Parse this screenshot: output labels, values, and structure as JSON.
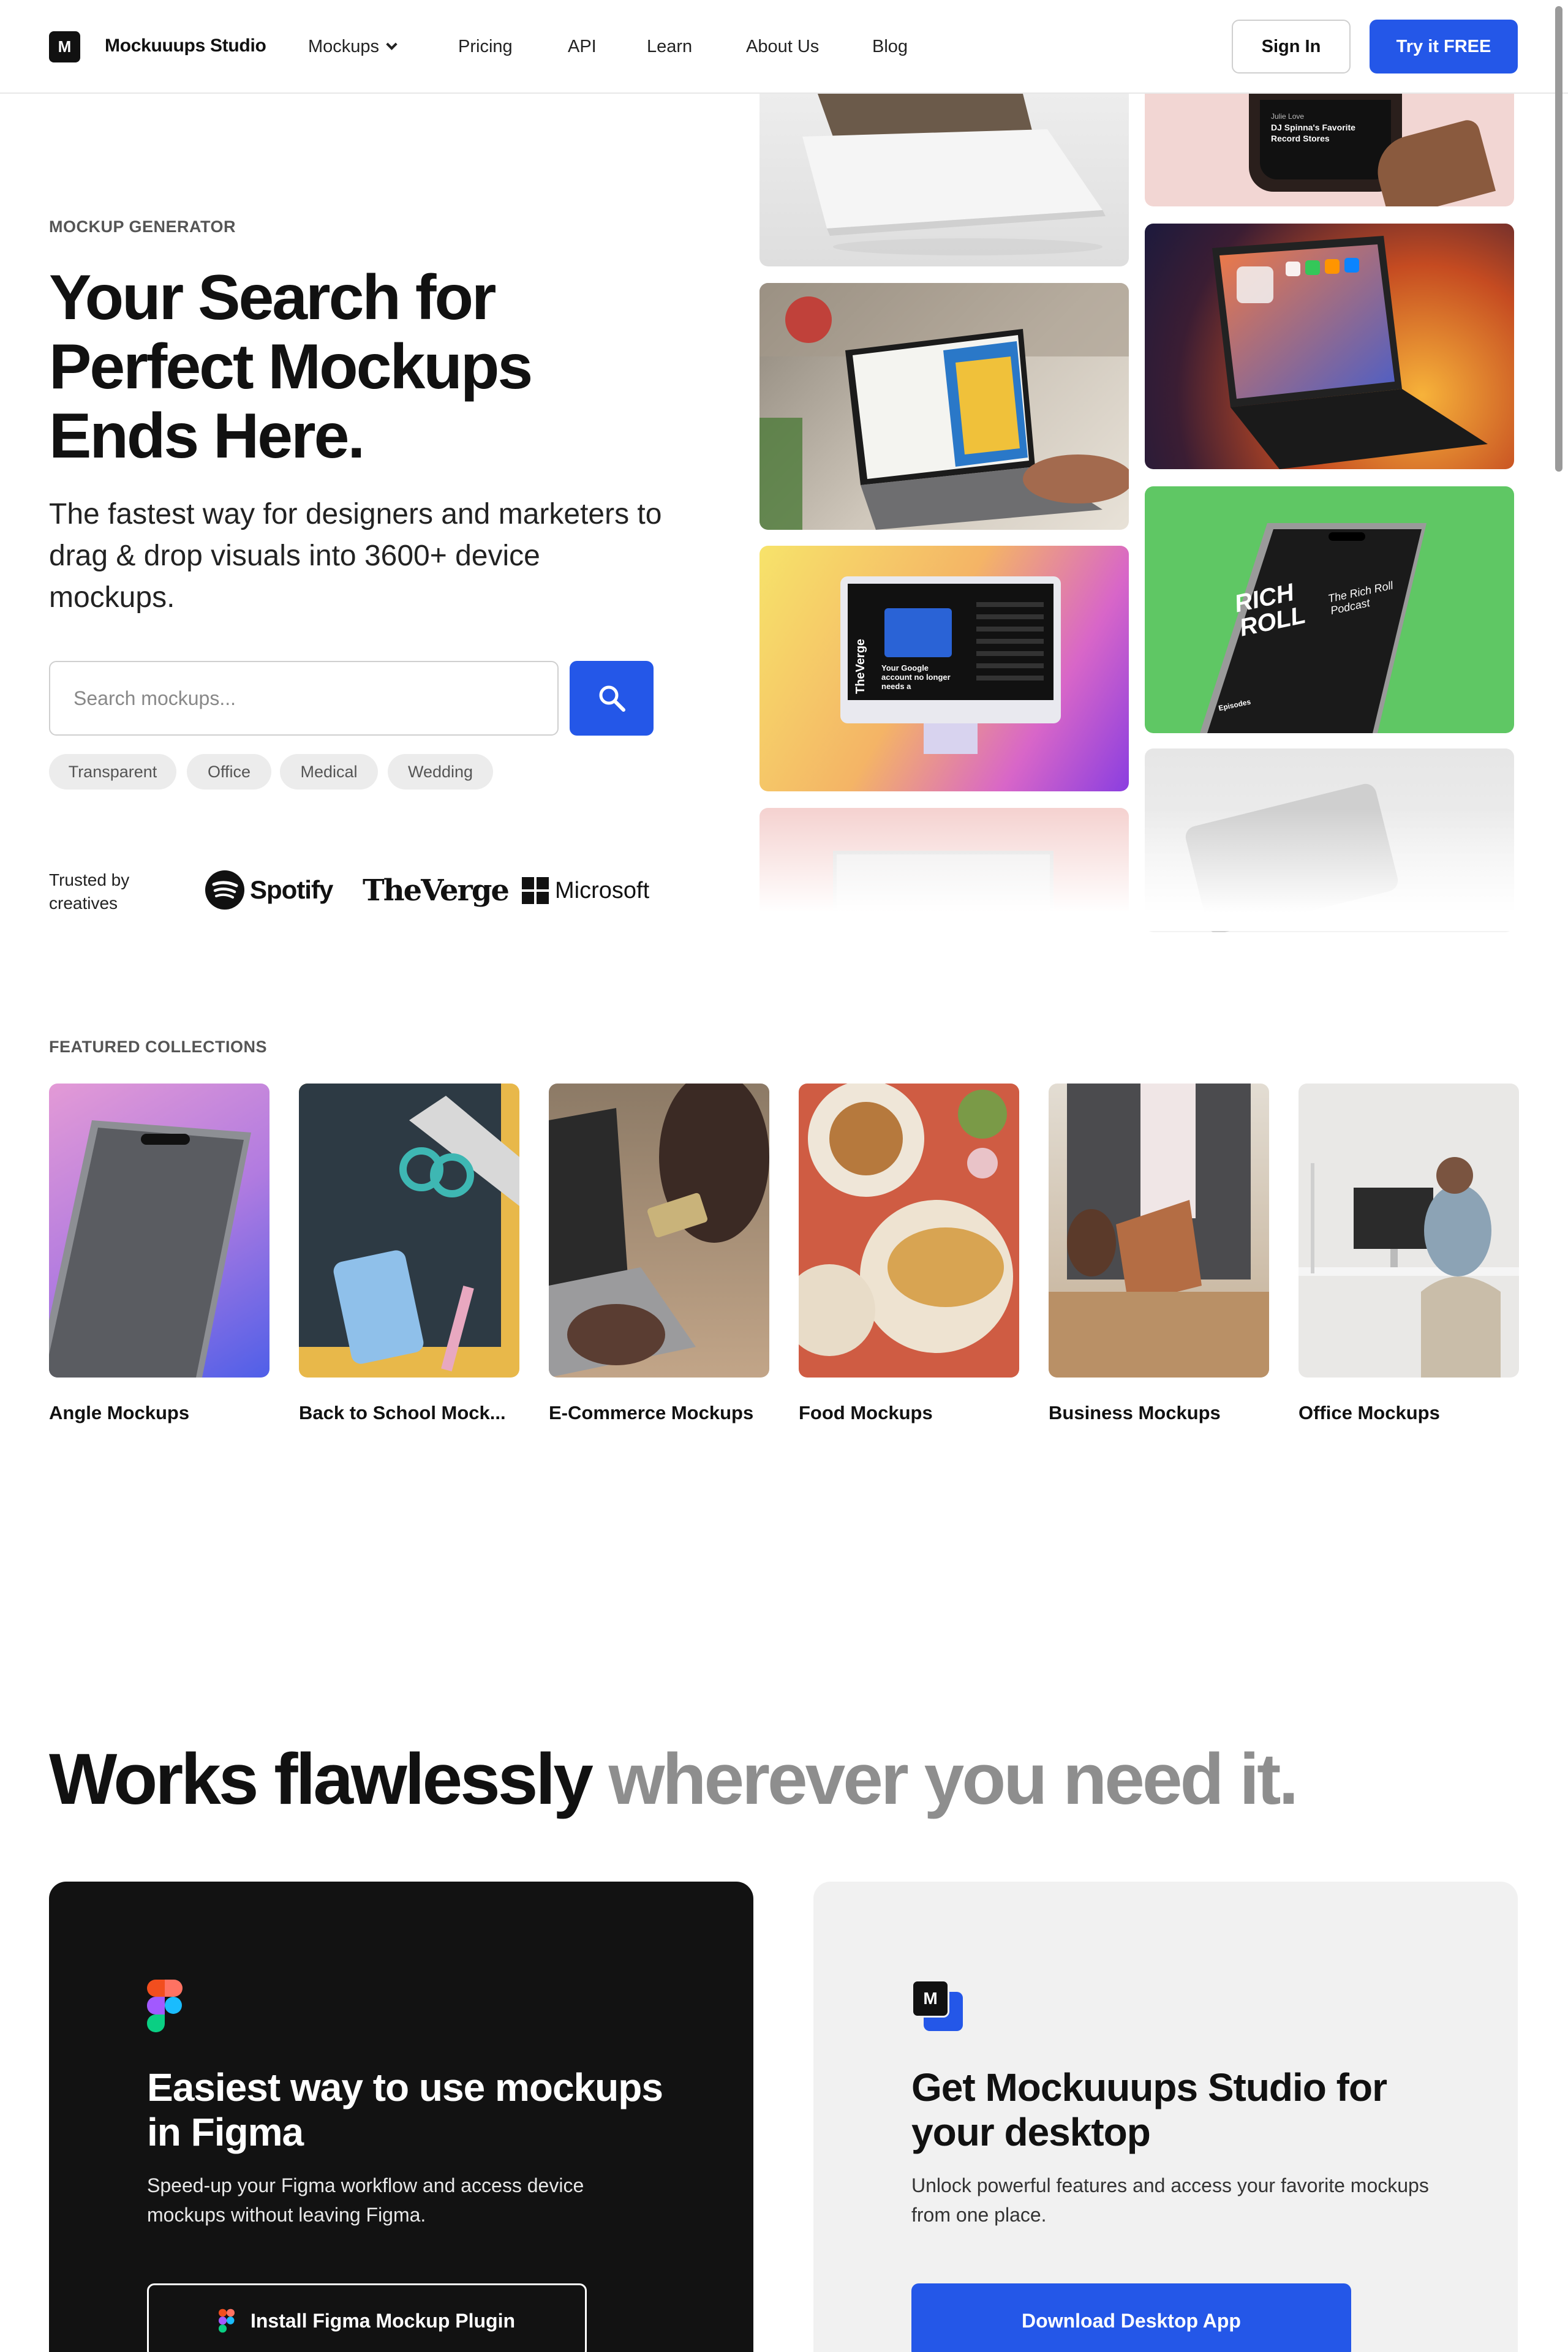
{
  "nav": {
    "logo_letter": "M",
    "brand": "Mockuuups Studio",
    "links": [
      "Mockups",
      "Pricing",
      "API",
      "Learn",
      "About Us",
      "Blog"
    ],
    "sign_in": "Sign In",
    "try_free": "Try it FREE"
  },
  "hero": {
    "eyebrow": "MOCKUP GENERATOR",
    "title": "Your Search for Perfect Mockups Ends Here.",
    "subtitle": "The fastest way for designers and marketers to drag & drop visuals into 3600+ device mockups.",
    "search_placeholder": "Search mockups...",
    "tags": [
      "Transparent",
      "Office",
      "Medical",
      "Wedding"
    ],
    "trusted_by": "Trusted by creatives",
    "logos": [
      "Spotify",
      "TheVerge",
      "Microsoft"
    ]
  },
  "tiles": {
    "phone_card_lines": [
      "Julie Love",
      "DJ Spinna's Favorite",
      "Record Stores"
    ],
    "podcast_title": "The Rich Roll Podcast",
    "podcast_big": "RICH ROLL",
    "podcast_episodes": "Episodes",
    "imac_headline": "Your Google account no longer needs a",
    "imac_side": "TheVerge"
  },
  "featured": {
    "heading": "FEATURED COLLECTIONS",
    "collections": [
      "Angle Mockups",
      "Back to School Mock...",
      "E-Commerce Mockups",
      "Food Mockups",
      "Business Mockups",
      "Office Mockups"
    ]
  },
  "works": {
    "dark": "Works flawlessly",
    "gray": "wherever you need it."
  },
  "figma_card": {
    "title": "Easiest way to use mockups in Figma",
    "subtitle": "Speed-up your Figma workflow and access device mockups without leaving Figma.",
    "button": "Install Figma Mockup Plugin"
  },
  "desktop_card": {
    "logo_letter": "M",
    "title": "Get Mockuuups Studio for your desktop",
    "subtitle": "Unlock powerful features and access your favorite mockups from one place.",
    "button": "Download Desktop App"
  },
  "colors": {
    "accent": "#2457e8",
    "dark_card": "#121212",
    "light_card": "#f1f1f1"
  }
}
